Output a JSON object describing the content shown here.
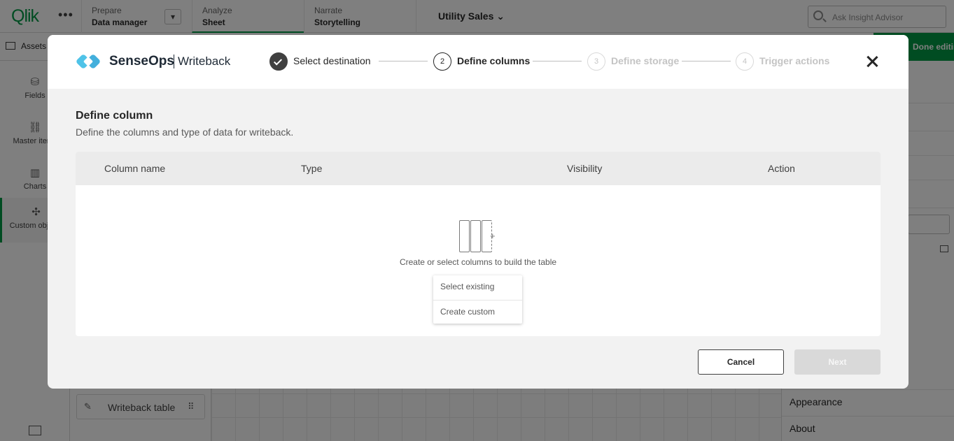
{
  "qlik": {
    "logo": "Qlik",
    "nav": [
      {
        "small": "Prepare",
        "main": "Data manager"
      },
      {
        "small": "Analyze",
        "main": "Sheet"
      },
      {
        "small": "Narrate",
        "main": "Storytelling"
      }
    ],
    "app_title": "Utility Sales",
    "insight_placeholder": "Ask Insight Advisor",
    "assets_tab": "Assets",
    "done_editing": "Done editing",
    "left_items": [
      "Fields",
      "Master items",
      "Charts",
      "Custom objects"
    ],
    "asset_card": "Writeback table",
    "right_items": [
      "Appearance",
      "About"
    ]
  },
  "modal": {
    "brand_name": "SenseOps",
    "brand_sub": "Writeback",
    "steps": [
      {
        "num": "1",
        "label": "Select destination",
        "state": "done"
      },
      {
        "num": "2",
        "label": "Define columns",
        "state": "current"
      },
      {
        "num": "3",
        "label": "Define storage",
        "state": "todo"
      },
      {
        "num": "4",
        "label": "Trigger actions",
        "state": "todo"
      }
    ],
    "section_title": "Define column",
    "section_desc": "Define the columns and type of data for writeback.",
    "columns": [
      "Column name",
      "Type",
      "Visibility",
      "Action"
    ],
    "empty_text": "Create or select columns to build the table",
    "menu": [
      "Select existing",
      "Create custom"
    ],
    "cancel": "Cancel",
    "next": "Next"
  },
  "colors": {
    "qlik_green": "#009845",
    "brand_blue": "#4fc3e8"
  }
}
